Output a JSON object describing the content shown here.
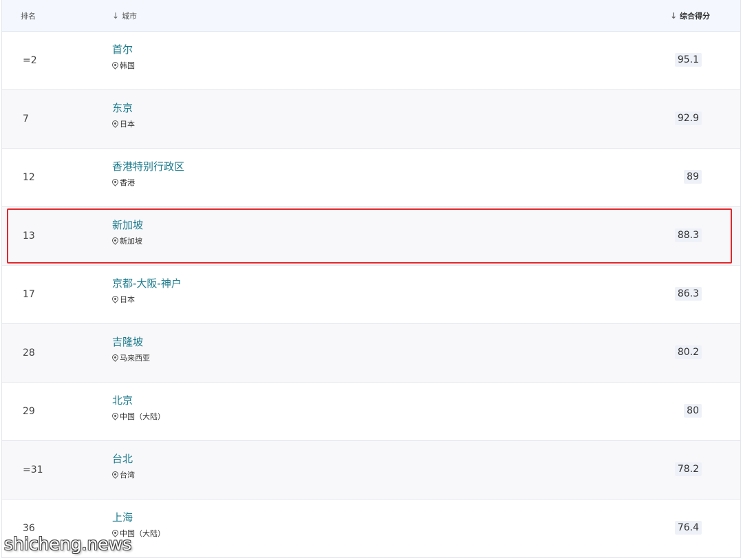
{
  "header": {
    "rank_label": "排名",
    "city_label": "城市",
    "score_label": "综合得分",
    "sort_arrow": "↓"
  },
  "rows": [
    {
      "rank": "=2",
      "city": "首尔",
      "country": "韩国",
      "score": "95.1"
    },
    {
      "rank": "7",
      "city": "东京",
      "country": "日本",
      "score": "92.9"
    },
    {
      "rank": "12",
      "city": "香港特别行政区",
      "country": "香港",
      "score": "89"
    },
    {
      "rank": "13",
      "city": "新加坡",
      "country": "新加坡",
      "score": "88.3"
    },
    {
      "rank": "17",
      "city": "京都-大阪-神户",
      "country": "日本",
      "score": "86.3"
    },
    {
      "rank": "28",
      "city": "吉隆坡",
      "country": "马来西亚",
      "score": "80.2"
    },
    {
      "rank": "29",
      "city": "北京",
      "country": "中国（大陆）",
      "score": "80"
    },
    {
      "rank": "=31",
      "city": "台北",
      "country": "台湾",
      "score": "78.2"
    },
    {
      "rank": "36",
      "city": "上海",
      "country": "中国（大陆）",
      "score": "76.4"
    }
  ],
  "highlighted_row": "13",
  "watermark": "shicheng.news",
  "colors": {
    "city_link": "#1a7a8c",
    "header_bg": "#f4f8fe",
    "highlight_border": "#e3262b",
    "score_bg": "#eef1f8"
  }
}
